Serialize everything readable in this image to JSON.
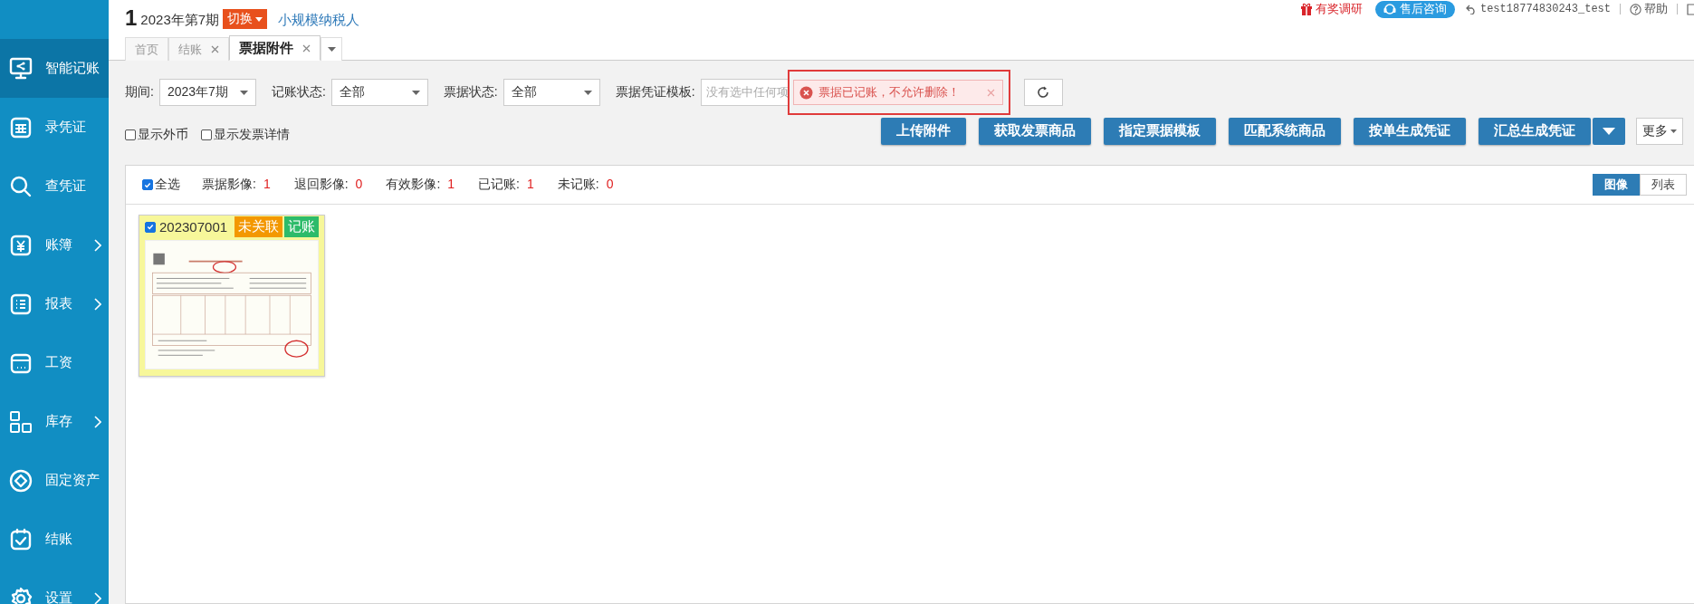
{
  "sidebar": {
    "items": [
      {
        "label": "智能记账",
        "selected": true,
        "has_submenu": false
      },
      {
        "label": "录凭证",
        "selected": false,
        "has_submenu": false
      },
      {
        "label": "查凭证",
        "selected": false,
        "has_submenu": false
      },
      {
        "label": "账簿",
        "selected": false,
        "has_submenu": true
      },
      {
        "label": "报表",
        "selected": false,
        "has_submenu": true
      },
      {
        "label": "工资",
        "selected": false,
        "has_submenu": false
      },
      {
        "label": "库存",
        "selected": false,
        "has_submenu": true
      },
      {
        "label": "固定资产",
        "selected": false,
        "has_submenu": false
      },
      {
        "label": "结账",
        "selected": false,
        "has_submenu": false
      },
      {
        "label": "设置",
        "selected": false,
        "has_submenu": true
      }
    ]
  },
  "header": {
    "period_number": "1",
    "period": "2023年第7期",
    "switch_button": "切换",
    "taxpayer_type": "小规模纳税人",
    "survey": "有奖调研",
    "support": "售后咨询",
    "user": "test18774830243_test",
    "help": "帮助"
  },
  "tabs": [
    {
      "label": "首页",
      "selected": false,
      "closable": false
    },
    {
      "label": "结账",
      "selected": false,
      "closable": true
    },
    {
      "label": "票据附件",
      "selected": true,
      "closable": true
    }
  ],
  "filters": [
    {
      "kind": "select",
      "label": "期间:",
      "value": "2023年7期"
    },
    {
      "kind": "select",
      "label": "记账状态:",
      "value": "全部"
    },
    {
      "kind": "select",
      "label": "票据状态:",
      "value": "全部"
    },
    {
      "kind": "input",
      "label": "票据凭证模板:",
      "placeholder": "没有选中任何项"
    }
  ],
  "toast": {
    "message": "票据已记账，不允许删除！",
    "highlighted": true
  },
  "options": [
    {
      "label": "显示外币",
      "checked": false
    },
    {
      "label": "显示发票详情",
      "checked": false
    }
  ],
  "toolbar_buttons": [
    "上传附件",
    "获取发票商品",
    "指定票据模板",
    "匹配系统商品",
    "按单生成凭证",
    "汇总生成凭证"
  ],
  "more_button": "更多",
  "summary": {
    "select_all": {
      "label": "全选",
      "checked": true
    },
    "stats": [
      {
        "label": "票据影像:",
        "value": "1"
      },
      {
        "label": "退回影像:",
        "value": "0"
      },
      {
        "label": "有效影像:",
        "value": "1"
      },
      {
        "label": "已记账:",
        "value": "1"
      },
      {
        "label": "未记账:",
        "value": "0"
      }
    ]
  },
  "view_toggle": [
    {
      "label": "图像",
      "selected": true
    },
    {
      "label": "列表",
      "selected": false
    }
  ],
  "cards": [
    {
      "number": "202307001",
      "checked": true,
      "badges": [
        {
          "label": "未关联",
          "color": "#f39800"
        },
        {
          "label": "记账",
          "color": "#2dbb6a"
        }
      ]
    }
  ]
}
